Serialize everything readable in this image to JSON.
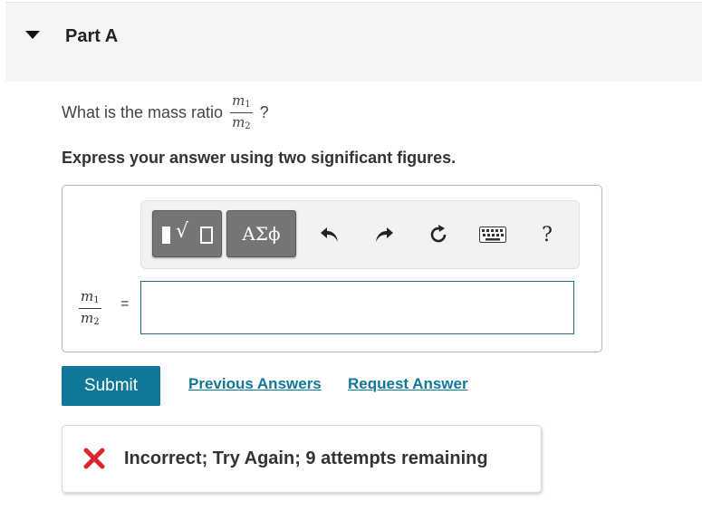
{
  "part": {
    "title": "Part A"
  },
  "question": {
    "prefix": "What is the mass ratio",
    "suffix": "?",
    "ratio": {
      "num_var": "m",
      "num_sub": "1",
      "den_var": "m",
      "den_sub": "2"
    }
  },
  "instructions": "Express your answer using two significant figures.",
  "toolbar": {
    "greek_label": "ΑΣϕ",
    "help_label": "?",
    "icons": [
      "templates-icon",
      "undo-icon",
      "redo-icon",
      "reset-icon",
      "keyboard-icon",
      "help-icon"
    ]
  },
  "answer": {
    "lhs": {
      "num_var": "m",
      "num_sub": "1",
      "den_var": "m",
      "den_sub": "2"
    },
    "equals": "=",
    "value": ""
  },
  "actions": {
    "submit_label": "Submit",
    "previous_answers_label": "Previous Answers",
    "request_answer_label": "Request Answer"
  },
  "feedback": {
    "message": "Incorrect; Try Again; 9 attempts remaining"
  },
  "colors": {
    "accent": "#0f7899",
    "toolbar_button": "#757575",
    "error": "#d9262b",
    "header_bg": "#f5f5f5"
  }
}
